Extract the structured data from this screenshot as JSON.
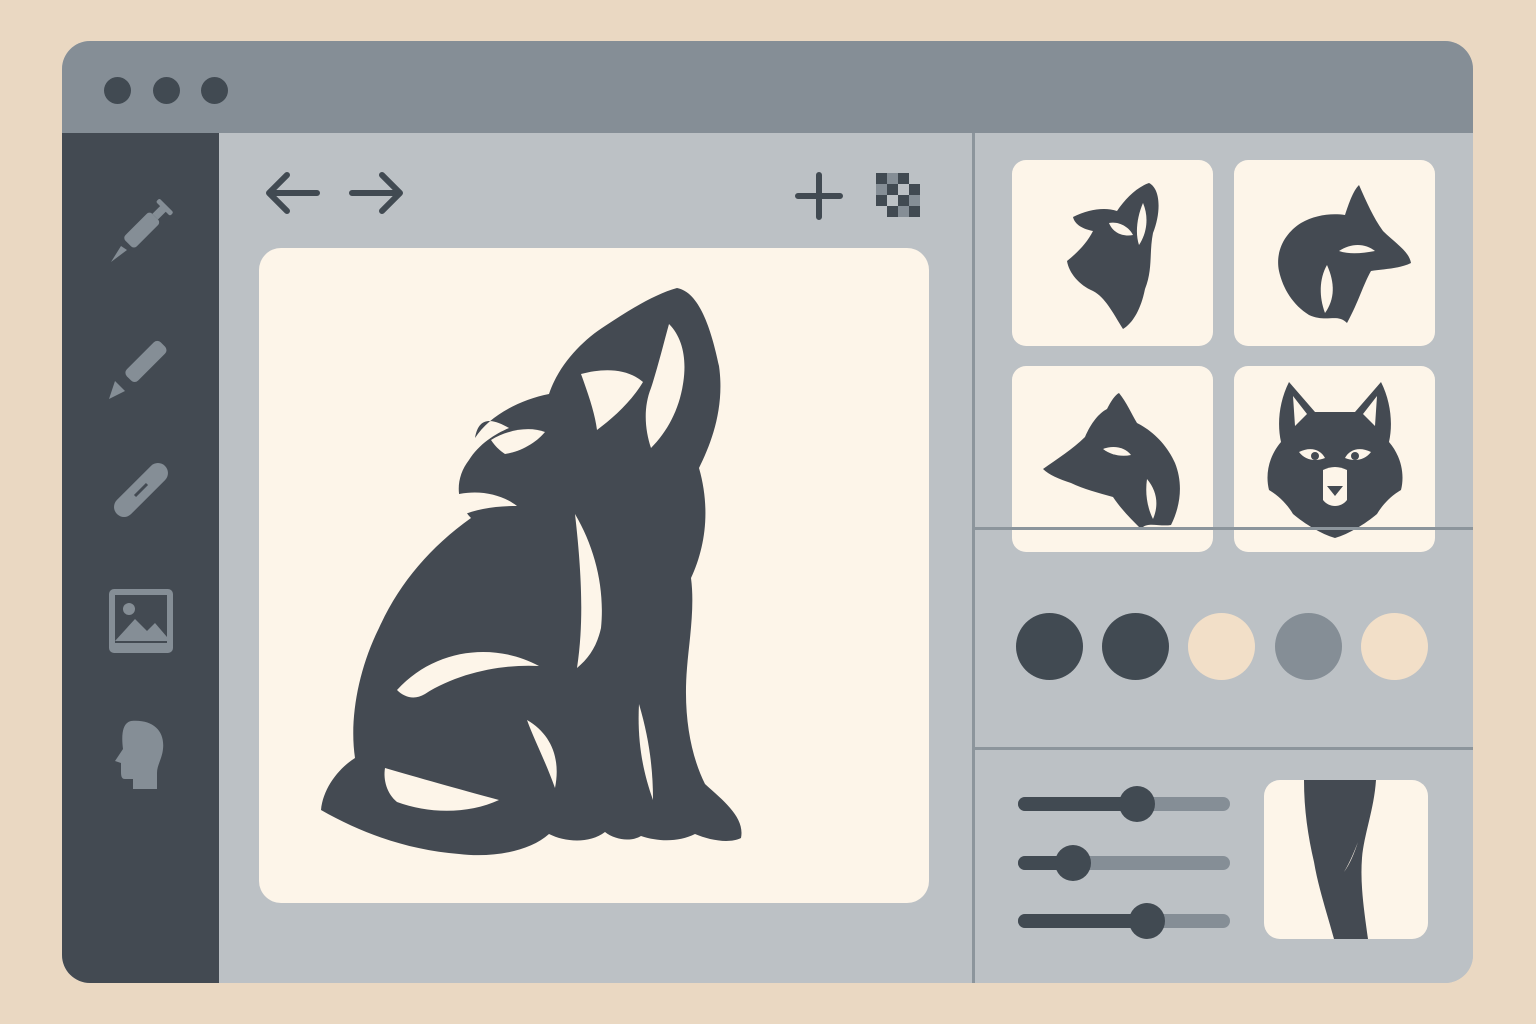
{
  "window": {
    "controls": [
      "close-dot",
      "minimize-dot",
      "maximize-dot"
    ]
  },
  "sidebar": {
    "tools": [
      {
        "name": "syringe-icon"
      },
      {
        "name": "pen-icon"
      },
      {
        "name": "brush-icon"
      },
      {
        "name": "image-icon"
      },
      {
        "name": "head-profile-icon"
      }
    ]
  },
  "toolbar": {
    "icons": [
      "arrow-left-icon",
      "arrow-right-icon",
      "plus-icon",
      "checkerboard-icon"
    ]
  },
  "canvas": {
    "subject": "howling-wolf-icon"
  },
  "gallery": {
    "thumbnails": [
      "howling-wolf-head-icon",
      "wolf-head-side-icon",
      "wolf-head-profile-icon",
      "wolf-face-front-icon"
    ]
  },
  "palette": {
    "swatches": [
      "#414a52",
      "#414a52",
      "#f2dfc8",
      "#858e96",
      "#f2dfc8"
    ]
  },
  "sliders": [
    {
      "value": 0.56
    },
    {
      "value": 0.26
    },
    {
      "value": 0.61
    }
  ],
  "preview": {
    "subject": "leg-silhouette-icon"
  }
}
